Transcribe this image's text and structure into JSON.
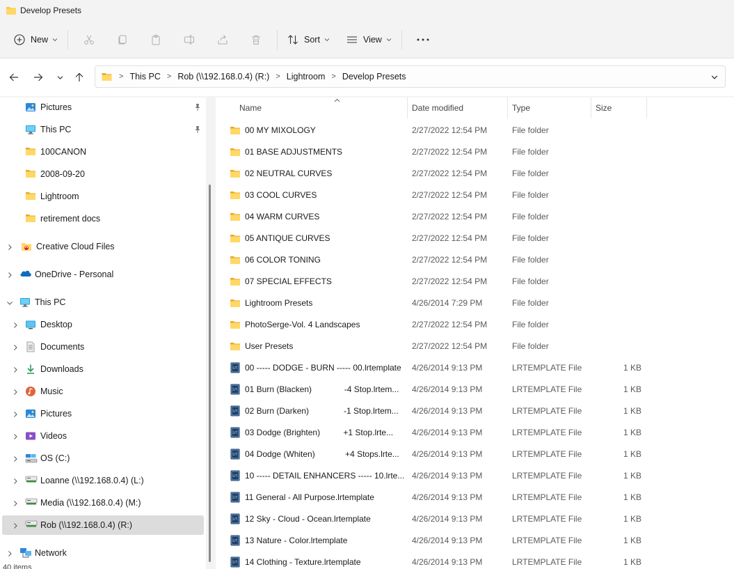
{
  "window": {
    "title": "Develop Presets"
  },
  "toolbar": {
    "new_label": "New",
    "sort_label": "Sort",
    "view_label": "View"
  },
  "breadcrumb": [
    "This PC",
    "Rob (\\\\192.168.0.4) (R:)",
    "Lightroom",
    "Develop Presets"
  ],
  "sidebar": {
    "items": [
      {
        "label": "Pictures",
        "icon": "pictures-icon",
        "pinned": true
      },
      {
        "label": "This PC",
        "icon": "pc-icon",
        "pinned": true
      },
      {
        "label": "100CANON",
        "icon": "folder-icon"
      },
      {
        "label": "2008-09-20",
        "icon": "folder-icon"
      },
      {
        "label": "Lightroom",
        "icon": "folder-icon"
      },
      {
        "label": "retirement docs",
        "icon": "folder-icon"
      },
      {
        "label": "Creative Cloud Files",
        "icon": "creative-cloud-icon"
      },
      {
        "label": "OneDrive - Personal",
        "icon": "onedrive-icon"
      },
      {
        "label": "This PC",
        "icon": "pc-icon",
        "expanded": true
      },
      {
        "label": "Desktop",
        "icon": "desktop-icon"
      },
      {
        "label": "Documents",
        "icon": "documents-icon"
      },
      {
        "label": "Downloads",
        "icon": "downloads-icon"
      },
      {
        "label": "Music",
        "icon": "music-icon"
      },
      {
        "label": "Pictures",
        "icon": "pictures-icon"
      },
      {
        "label": "Videos",
        "icon": "videos-icon"
      },
      {
        "label": "OS (C:)",
        "icon": "drive-icon"
      },
      {
        "label": "Loanne (\\\\192.168.0.4) (L:)",
        "icon": "network-drive-icon"
      },
      {
        "label": "Media (\\\\192.168.0.4) (M:)",
        "icon": "network-drive-icon"
      },
      {
        "label": "Rob (\\\\192.168.0.4) (R:)",
        "icon": "network-drive-icon",
        "selected": true
      },
      {
        "label": "Network",
        "icon": "network-icon"
      }
    ]
  },
  "columns": {
    "name": "Name",
    "date": "Date modified",
    "type": "Type",
    "size": "Size"
  },
  "files": [
    {
      "name": "00 MY MIXOLOGY",
      "date": "2/27/2022 12:54 PM",
      "type": "File folder",
      "size": "",
      "kind": "folder"
    },
    {
      "name": "01 BASE ADJUSTMENTS",
      "date": "2/27/2022 12:54 PM",
      "type": "File folder",
      "size": "",
      "kind": "folder"
    },
    {
      "name": "02 NEUTRAL CURVES",
      "date": "2/27/2022 12:54 PM",
      "type": "File folder",
      "size": "",
      "kind": "folder"
    },
    {
      "name": "03 COOL CURVES",
      "date": "2/27/2022 12:54 PM",
      "type": "File folder",
      "size": "",
      "kind": "folder"
    },
    {
      "name": "04 WARM CURVES",
      "date": "2/27/2022 12:54 PM",
      "type": "File folder",
      "size": "",
      "kind": "folder"
    },
    {
      "name": "05 ANTIQUE CURVES",
      "date": "2/27/2022 12:54 PM",
      "type": "File folder",
      "size": "",
      "kind": "folder"
    },
    {
      "name": "06 COLOR TONING",
      "date": "2/27/2022 12:54 PM",
      "type": "File folder",
      "size": "",
      "kind": "folder"
    },
    {
      "name": "07 SPECIAL EFFECTS",
      "date": "2/27/2022 12:54 PM",
      "type": "File folder",
      "size": "",
      "kind": "folder"
    },
    {
      "name": "Lightroom Presets",
      "date": "4/26/2014 7:29 PM",
      "type": "File folder",
      "size": "",
      "kind": "folder"
    },
    {
      "name": "PhotoSerge-Vol. 4 Landscapes",
      "date": "2/27/2022 12:54 PM",
      "type": "File folder",
      "size": "",
      "kind": "folder"
    },
    {
      "name": "User Presets",
      "date": "2/27/2022 12:54 PM",
      "type": "File folder",
      "size": "",
      "kind": "folder"
    },
    {
      "name": "00 ----- DODGE - BURN ----- 00.lrtemplate",
      "date": "4/26/2014 9:13 PM",
      "type": "LRTEMPLATE File",
      "size": "1 KB",
      "kind": "file"
    },
    {
      "name": "01 Burn (Blacken)              -4 Stop.lrtem...",
      "date": "4/26/2014 9:13 PM",
      "type": "LRTEMPLATE File",
      "size": "1 KB",
      "kind": "file"
    },
    {
      "name": "02 Burn (Darken)               -1 Stop.lrtem...",
      "date": "4/26/2014 9:13 PM",
      "type": "LRTEMPLATE File",
      "size": "1 KB",
      "kind": "file"
    },
    {
      "name": "03 Dodge (Brighten)          +1 Stop.lrte...",
      "date": "4/26/2014 9:13 PM",
      "type": "LRTEMPLATE File",
      "size": "1 KB",
      "kind": "file"
    },
    {
      "name": "04 Dodge (Whiten)             +4 Stops.lrte...",
      "date": "4/26/2014 9:13 PM",
      "type": "LRTEMPLATE File",
      "size": "1 KB",
      "kind": "file"
    },
    {
      "name": "10 ----- DETAIL ENHANCERS ----- 10.lrte...",
      "date": "4/26/2014 9:13 PM",
      "type": "LRTEMPLATE File",
      "size": "1 KB",
      "kind": "file"
    },
    {
      "name": "11 General - All Purpose.lrtemplate",
      "date": "4/26/2014 9:13 PM",
      "type": "LRTEMPLATE File",
      "size": "1 KB",
      "kind": "file"
    },
    {
      "name": "12 Sky - Cloud - Ocean.lrtemplate",
      "date": "4/26/2014 9:13 PM",
      "type": "LRTEMPLATE File",
      "size": "1 KB",
      "kind": "file"
    },
    {
      "name": "13 Nature - Color.lrtemplate",
      "date": "4/26/2014 9:13 PM",
      "type": "LRTEMPLATE File",
      "size": "1 KB",
      "kind": "file"
    },
    {
      "name": "14 Clothing - Texture.lrtemplate",
      "date": "4/26/2014 9:13 PM",
      "type": "LRTEMPLATE File",
      "size": "1 KB",
      "kind": "file"
    }
  ],
  "status": {
    "items_count": "40 items"
  },
  "colors": {
    "folder": "#f7c848",
    "folder_dark": "#e8a92a",
    "lrtemplate": "#1f3f66",
    "selection": "#dcdcdc",
    "accent": "#0067c0"
  }
}
